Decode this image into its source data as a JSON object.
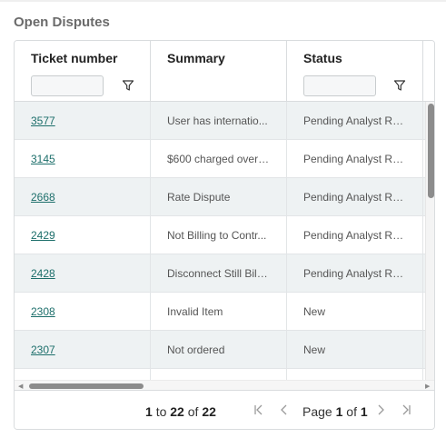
{
  "title": "Open Disputes",
  "columns": [
    "Ticket number",
    "Summary",
    "Status"
  ],
  "rows": [
    {
      "ticket": "3577",
      "summary": "User has internatio...",
      "status": "Pending Analyst Re..."
    },
    {
      "ticket": "3145",
      "summary": "$600 charged over ...",
      "status": "Pending Analyst Re..."
    },
    {
      "ticket": "2668",
      "summary": "Rate Dispute",
      "status": "Pending Analyst Re..."
    },
    {
      "ticket": "2429",
      "summary": "Not Billing to Contr...",
      "status": "Pending Analyst Re..."
    },
    {
      "ticket": "2428",
      "summary": "Disconnect Still Billi...",
      "status": "Pending Analyst Re..."
    },
    {
      "ticket": "2308",
      "summary": "Invalid Item",
      "status": "New"
    },
    {
      "ticket": "2307",
      "summary": "Not ordered",
      "status": "New"
    }
  ],
  "pagination": {
    "from": "1",
    "to_word": "to",
    "to": "22",
    "of_word": "of",
    "total": "22",
    "page_word": "Page",
    "page": "1",
    "page_of_word": "of",
    "pages": "1"
  },
  "icons": {
    "filter": "filter-icon",
    "first": "first-page-icon",
    "prev": "previous-page-icon",
    "next": "next-page-icon",
    "last": "last-page-icon"
  },
  "colors": {
    "link": "#1d6f6b",
    "row_alt": "#eef2f3",
    "border": "#d9dcde"
  }
}
